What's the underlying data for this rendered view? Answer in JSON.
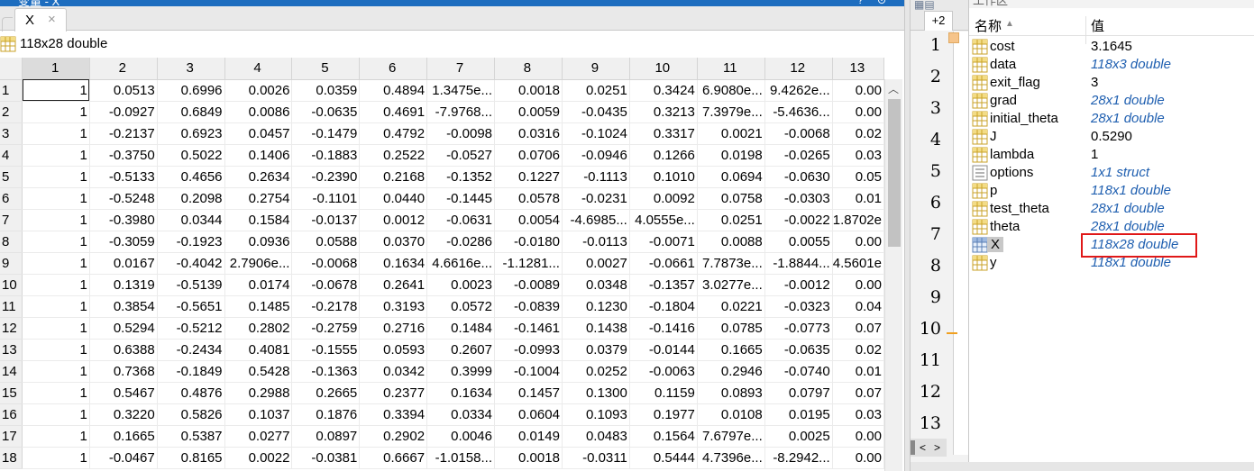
{
  "variable_editor": {
    "window_title": "变量 - X",
    "tab_label": "X",
    "tab_close": "×",
    "size_info": "118x28 double",
    "columns": [
      "",
      "1",
      "2",
      "3",
      "4",
      "5",
      "6",
      "7",
      "8",
      "9",
      "10",
      "11",
      "12",
      "13"
    ],
    "rows": [
      [
        "1",
        "1",
        "0.0513",
        "0.6996",
        "0.0026",
        "0.0359",
        "0.4894",
        "1.3475e...",
        "0.0018",
        "0.0251",
        "0.3424",
        "6.9080e...",
        "9.4262e...",
        "0.00"
      ],
      [
        "2",
        "1",
        "-0.0927",
        "0.6849",
        "0.0086",
        "-0.0635",
        "0.4691",
        "-7.9768...",
        "0.0059",
        "-0.0435",
        "0.3213",
        "7.3979e...",
        "-5.4636...",
        "0.00"
      ],
      [
        "3",
        "1",
        "-0.2137",
        "0.6923",
        "0.0457",
        "-0.1479",
        "0.4792",
        "-0.0098",
        "0.0316",
        "-0.1024",
        "0.3317",
        "0.0021",
        "-0.0068",
        "0.02"
      ],
      [
        "4",
        "1",
        "-0.3750",
        "0.5022",
        "0.1406",
        "-0.1883",
        "0.2522",
        "-0.0527",
        "0.0706",
        "-0.0946",
        "0.1266",
        "0.0198",
        "-0.0265",
        "0.03"
      ],
      [
        "5",
        "1",
        "-0.5133",
        "0.4656",
        "0.2634",
        "-0.2390",
        "0.2168",
        "-0.1352",
        "0.1227",
        "-0.1113",
        "0.1010",
        "0.0694",
        "-0.0630",
        "0.05"
      ],
      [
        "6",
        "1",
        "-0.5248",
        "0.2098",
        "0.2754",
        "-0.1101",
        "0.0440",
        "-0.1445",
        "0.0578",
        "-0.0231",
        "0.0092",
        "0.0758",
        "-0.0303",
        "0.01"
      ],
      [
        "7",
        "1",
        "-0.3980",
        "0.0344",
        "0.1584",
        "-0.0137",
        "0.0012",
        "-0.0631",
        "0.0054",
        "-4.6985...",
        "4.0555e...",
        "0.0251",
        "-0.0022",
        "1.8702e"
      ],
      [
        "8",
        "1",
        "-0.3059",
        "-0.1923",
        "0.0936",
        "0.0588",
        "0.0370",
        "-0.0286",
        "-0.0180",
        "-0.0113",
        "-0.0071",
        "0.0088",
        "0.0055",
        "0.00"
      ],
      [
        "9",
        "1",
        "0.0167",
        "-0.4042",
        "2.7906e...",
        "-0.0068",
        "0.1634",
        "4.6616e...",
        "-1.1281...",
        "0.0027",
        "-0.0661",
        "7.7873e...",
        "-1.8844...",
        "4.5601e"
      ],
      [
        "10",
        "1",
        "0.1319",
        "-0.5139",
        "0.0174",
        "-0.0678",
        "0.2641",
        "0.0023",
        "-0.0089",
        "0.0348",
        "-0.1357",
        "3.0277e...",
        "-0.0012",
        "0.00"
      ],
      [
        "11",
        "1",
        "0.3854",
        "-0.5651",
        "0.1485",
        "-0.2178",
        "0.3193",
        "0.0572",
        "-0.0839",
        "0.1230",
        "-0.1804",
        "0.0221",
        "-0.0323",
        "0.04"
      ],
      [
        "12",
        "1",
        "0.5294",
        "-0.5212",
        "0.2802",
        "-0.2759",
        "0.2716",
        "0.1484",
        "-0.1461",
        "0.1438",
        "-0.1416",
        "0.0785",
        "-0.0773",
        "0.07"
      ],
      [
        "13",
        "1",
        "0.6388",
        "-0.2434",
        "0.4081",
        "-0.1555",
        "0.0593",
        "0.2607",
        "-0.0993",
        "0.0379",
        "-0.0144",
        "0.1665",
        "-0.0635",
        "0.02"
      ],
      [
        "14",
        "1",
        "0.7368",
        "-0.1849",
        "0.5428",
        "-0.1363",
        "0.0342",
        "0.3999",
        "-0.1004",
        "0.0252",
        "-0.0063",
        "0.2946",
        "-0.0740",
        "0.01"
      ],
      [
        "15",
        "1",
        "0.5467",
        "0.4876",
        "0.2988",
        "0.2665",
        "0.2377",
        "0.1634",
        "0.1457",
        "0.1300",
        "0.1159",
        "0.0893",
        "0.0797",
        "0.07"
      ],
      [
        "16",
        "1",
        "0.3220",
        "0.5826",
        "0.1037",
        "0.1876",
        "0.3394",
        "0.0334",
        "0.0604",
        "0.1093",
        "0.1977",
        "0.0108",
        "0.0195",
        "0.03"
      ],
      [
        "17",
        "1",
        "0.1665",
        "0.5387",
        "0.0277",
        "0.0897",
        "0.2902",
        "0.0046",
        "0.0149",
        "0.0483",
        "0.1564",
        "7.6797e...",
        "0.0025",
        "0.00"
      ],
      [
        "18",
        "1",
        "-0.0467",
        "0.8165",
        "0.0022",
        "-0.0381",
        "0.6667",
        "-1.0158...",
        "0.0018",
        "-0.0311",
        "0.5444",
        "4.7396e...",
        "-8.2942...",
        "0.00"
      ]
    ]
  },
  "editor_strip": {
    "tab_count": "+2",
    "line_numbers": [
      "1",
      "2",
      "3",
      "4",
      "5",
      "6",
      "7",
      "8",
      "9",
      "10",
      "11",
      "12",
      "13"
    ],
    "scroll_left": "<",
    "scroll_right": ">"
  },
  "workspace": {
    "title": "工作区",
    "col_name": "名称",
    "col_value": "值",
    "variables": [
      {
        "name": "cost",
        "value": "3.1645",
        "italic": false,
        "icon": "matrix-icon"
      },
      {
        "name": "data",
        "value": "118x3 double",
        "italic": true,
        "icon": "matrix-icon"
      },
      {
        "name": "exit_flag",
        "value": "3",
        "italic": false,
        "icon": "matrix-icon"
      },
      {
        "name": "grad",
        "value": "28x1 double",
        "italic": true,
        "icon": "matrix-icon"
      },
      {
        "name": "initial_theta",
        "value": "28x1 double",
        "italic": true,
        "icon": "matrix-icon"
      },
      {
        "name": "J",
        "value": "0.5290",
        "italic": false,
        "icon": "matrix-icon"
      },
      {
        "name": "lambda",
        "value": "1",
        "italic": false,
        "icon": "matrix-icon"
      },
      {
        "name": "options",
        "value": "1x1 struct",
        "italic": true,
        "icon": "struct-icon"
      },
      {
        "name": "p",
        "value": "118x1 double",
        "italic": true,
        "icon": "matrix-icon"
      },
      {
        "name": "test_theta",
        "value": "28x1 double",
        "italic": true,
        "icon": "matrix-icon"
      },
      {
        "name": "theta",
        "value": "28x1 double",
        "italic": true,
        "icon": "matrix-icon"
      },
      {
        "name": "X",
        "value": "118x28 double",
        "italic": true,
        "icon": "matrix-icon",
        "selected": true
      },
      {
        "name": "y",
        "value": "118x1 double",
        "italic": true,
        "icon": "matrix-icon"
      }
    ]
  },
  "colors": {
    "titlebar": "#1d6dbf",
    "italic_value": "#1f5fb0",
    "highlight_box": "#e01818"
  }
}
